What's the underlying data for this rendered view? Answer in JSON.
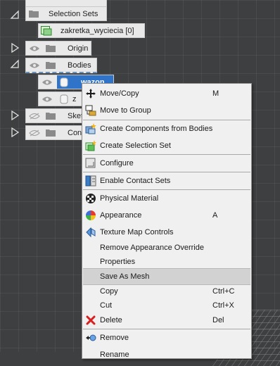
{
  "browser": {
    "selection_sets": "Selection Sets",
    "zakretka": "zakretka_wyciecia [0]",
    "origin": "Origin",
    "bodies": "Bodies",
    "body_wazon": "wazon",
    "body_second": "z",
    "sketches": "Sket",
    "construction": "Cons"
  },
  "menu": {
    "move_copy": "Move/Copy",
    "move_copy_sc": "M",
    "move_to_group": "Move to Group",
    "create_components": "Create Components from Bodies",
    "create_selection_set": "Create Selection Set",
    "configure": "Configure",
    "enable_contact_sets": "Enable Contact Sets",
    "physical_material": "Physical Material",
    "appearance": "Appearance",
    "appearance_sc": "A",
    "texture_map_controls": "Texture Map Controls",
    "remove_appearance_override": "Remove Appearance Override",
    "properties": "Properties",
    "save_as_mesh": "Save As Mesh",
    "copy": "Copy",
    "copy_sc": "Ctrl+C",
    "cut": "Cut",
    "cut_sc": "Ctrl+X",
    "delete": "Delete",
    "delete_sc": "Del",
    "remove": "Remove",
    "rename": "Rename"
  },
  "colors": {
    "viewport": "#3e3f40",
    "menu_bg": "#f0f0f0",
    "highlight": "#d2d2d2",
    "selected_node": "#2f74c9",
    "delete_red": "#d82020"
  }
}
